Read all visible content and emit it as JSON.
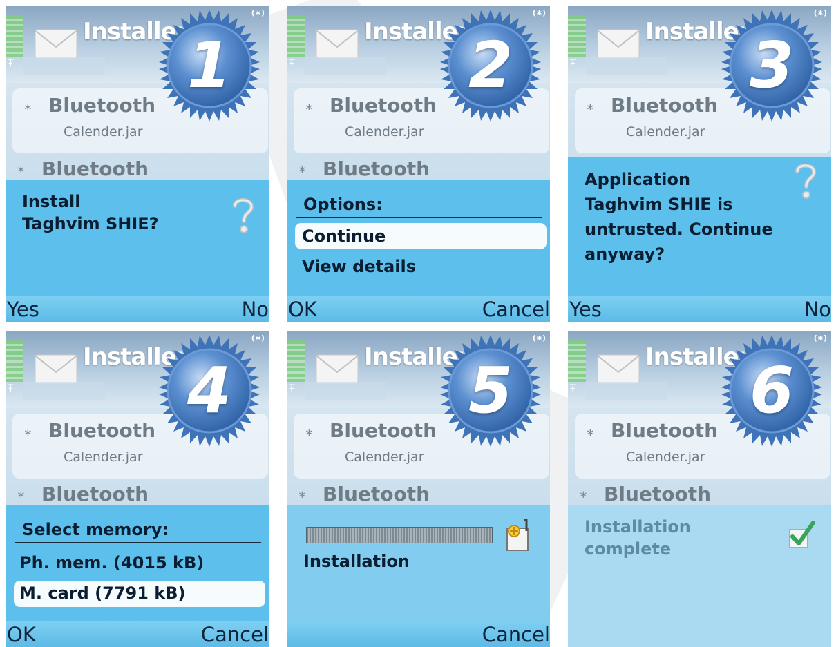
{
  "app_title": "Installer",
  "badge_numbers": [
    "1",
    "2",
    "3",
    "4",
    "5",
    "6"
  ],
  "list": {
    "item1_title": "Bluetooth",
    "item1_file": "Calender.jar",
    "item2_title": "Bluetooth"
  },
  "icons": {
    "status": "bluetooth-status-icon",
    "message": "envelope-icon",
    "question": "question-mark-icon",
    "install": "install-package-icon",
    "done": "checkmark-icon"
  },
  "status_glyph": "(∗)",
  "bt_glyph": "∗",
  "antenna_glyph": "Ŧ",
  "panels": [
    {
      "dialog": {
        "line1": "Install",
        "line2": "Taghvim SHIE?"
      },
      "softkeys": {
        "left": "Yes",
        "right": "No"
      }
    },
    {
      "dialog": {
        "heading": "Options:",
        "options": [
          "Continue",
          "View details"
        ],
        "selected": 0
      },
      "softkeys": {
        "left": "OK",
        "right": "Cancel"
      }
    },
    {
      "dialog": {
        "line1": "Application",
        "line2": "Taghvim SHIE is",
        "line3": "untrusted. Continue",
        "line4": "anyway?"
      },
      "softkeys": {
        "left": "Yes",
        "right": "No"
      }
    },
    {
      "dialog": {
        "heading": "Select memory:",
        "options": [
          "Ph. mem. (4015 kB)",
          "M. card (7791 kB)"
        ],
        "selected": 1
      },
      "softkeys": {
        "left": "OK",
        "right": "Cancel"
      }
    },
    {
      "dialog": {
        "label": "Installation",
        "progress": 1.0
      },
      "softkeys": {
        "left": "",
        "right": "Cancel"
      }
    },
    {
      "dialog": {
        "line1": "Installation",
        "line2": "complete"
      },
      "softkeys": {
        "left": "",
        "right": ""
      }
    }
  ],
  "colors": {
    "dialog_bg": "#5dbfec",
    "highlight": "#f6fbfe",
    "text_dark": "#0b1e31",
    "badge_blue": "#4f86c8"
  }
}
